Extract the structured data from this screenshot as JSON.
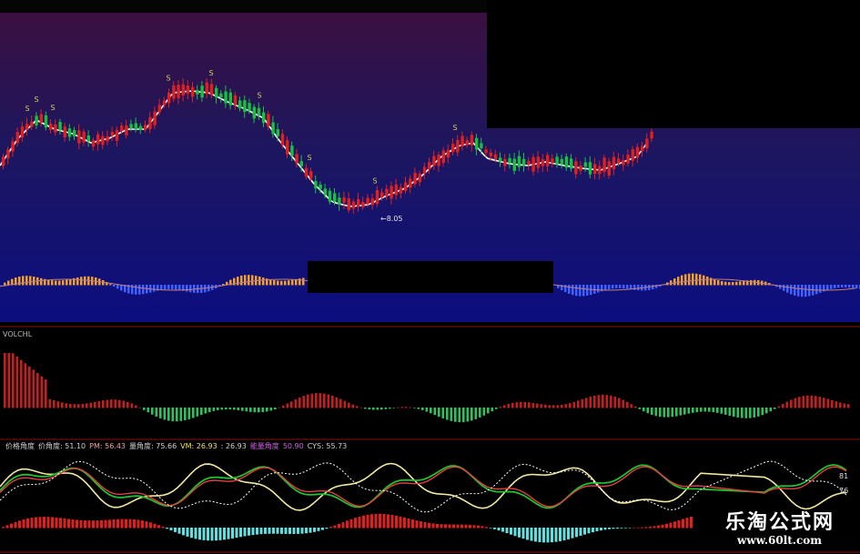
{
  "chart_data": [
    {
      "type": "candlestick",
      "panel": "price",
      "signals": [
        "S",
        "S",
        "S",
        "S",
        "S",
        "S",
        "S",
        "S",
        "S"
      ],
      "annotation": "8.05",
      "colors": {
        "up": "#e02020",
        "down": "#18c040",
        "ma": "#ffffff",
        "bg_top": "#3a1040",
        "bg_bottom": "#101070"
      }
    },
    {
      "type": "bar",
      "panel": "VOLCHL",
      "title": "VOLCHL",
      "colors": {
        "positive": "#c02020",
        "negative": "#30c060"
      }
    },
    {
      "type": "line",
      "panel": "angle",
      "legend": [
        {
          "label": "价格角度",
          "color": "#d0d0d0"
        },
        {
          "label": "价角度: 51.10",
          "color": "#d0d0d0"
        },
        {
          "label": "PM: 56.43",
          "color": "#f0a0a0"
        },
        {
          "label": "量角度: 75.66",
          "color": "#d0d0d0"
        },
        {
          "label": "VM: 26.93",
          "color": "#f0e060"
        },
        {
          "label": ": 26.93",
          "color": "#d0d0d0"
        },
        {
          "label": "能量角度",
          "color": "#d060e0"
        },
        {
          "label": "50.90",
          "color": "#d060e0"
        },
        {
          "label": "CYS: 55.73",
          "color": "#d0d0d0"
        }
      ],
      "right_labels": [
        "81",
        "76"
      ]
    }
  ],
  "watermark": {
    "title": "乐淘公式网",
    "url": "www.60lt.com"
  }
}
